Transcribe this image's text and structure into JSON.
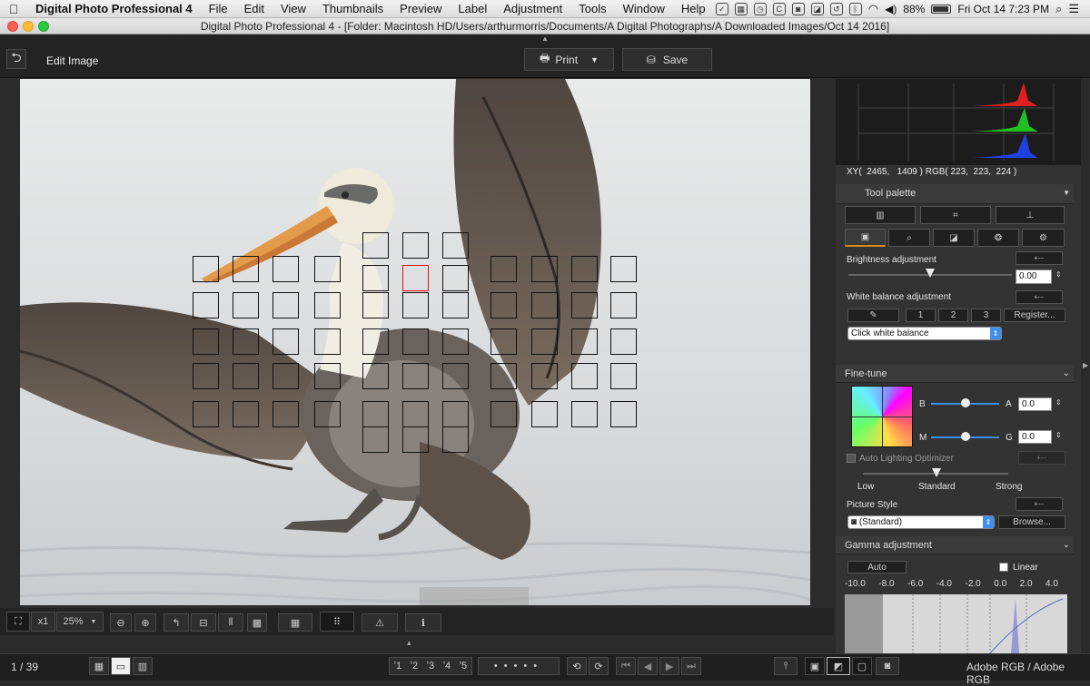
{
  "menubar": {
    "app_name": "Digital Photo Professional 4",
    "items": [
      "File",
      "Edit",
      "View",
      "Thumbnails",
      "Preview",
      "Label",
      "Adjustment",
      "Tools",
      "Window",
      "Help"
    ],
    "battery": "88%",
    "datetime": "Fri Oct 14  7:23 PM"
  },
  "window": {
    "title": "Digital Photo Professional 4 - [Folder: Macintosh HD/Users/arthurmorris/Documents/A Digital Photographs/A Downloaded Images/Oct 14 2016]"
  },
  "toolbar": {
    "mode_label": "Edit Image",
    "print_label": "Print",
    "save_label": "Save"
  },
  "histogram": {
    "readout": "XY(  2465,   1409 ) RGB( 223,  223,  224 )"
  },
  "tool_palette": {
    "title": "Tool palette",
    "brightness": {
      "label": "Brightness adjustment",
      "value": "0.00"
    },
    "white_balance": {
      "label": "White balance adjustment",
      "presets": [
        "1",
        "2",
        "3"
      ],
      "register_label": "Register...",
      "select_value": "Click white balance"
    },
    "fine_tune": {
      "label": "Fine-tune",
      "b_label": "B",
      "a_label": "A",
      "a_value": "0.0",
      "m_label": "M",
      "g_label": "G",
      "g_value": "0.0"
    },
    "alo": {
      "label": "Auto Lighting Optimizer",
      "low": "Low",
      "standard": "Standard",
      "strong": "Strong"
    },
    "picture_style": {
      "label": "Picture Style",
      "value": "(Standard)",
      "browse_label": "Browse..."
    },
    "gamma": {
      "label": "Gamma adjustment",
      "auto_label": "Auto",
      "linear_label": "Linear",
      "ticks": [
        "-10.0",
        "-8.0",
        "-6.0",
        "-4.0",
        "-2.0",
        "0.0",
        "2.0",
        "4.0"
      ]
    }
  },
  "bottombar": {
    "zoom_multiplier": "x1",
    "zoom_value": "25%",
    "selected_points": "Selected AF point"
  },
  "statusbar": {
    "counter": "1 / 39",
    "ratings": [
      "ʹ1",
      "ʹ2",
      "ʹ3",
      "ʹ4",
      "ʹ5"
    ],
    "color_space": "Adobe RGB / Adobe RGB"
  },
  "colors": {
    "accent": "#3d8ef0",
    "af_selected": "#e01010"
  }
}
